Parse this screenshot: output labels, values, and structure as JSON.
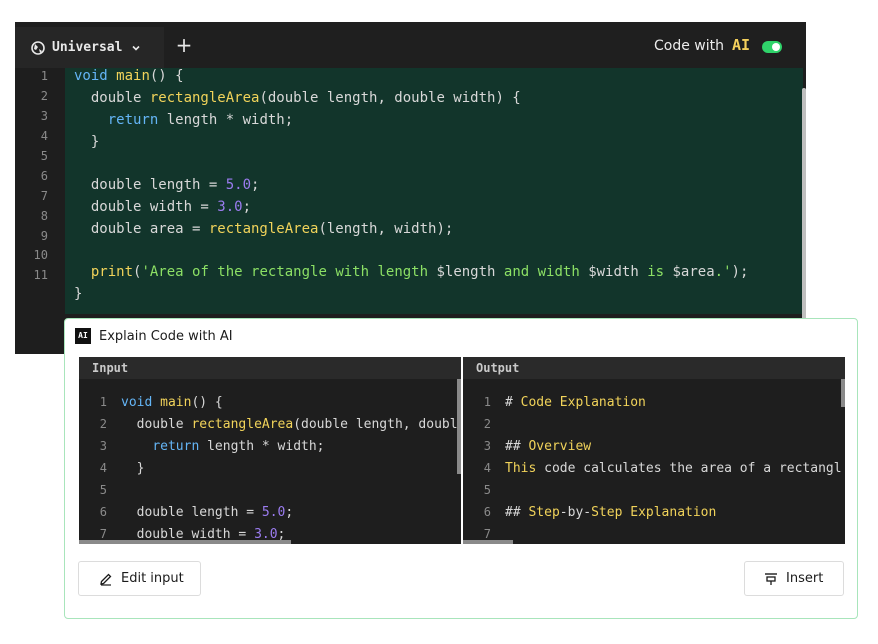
{
  "editor": {
    "tab_label": "Universal",
    "add_tab_symbol": "+",
    "code_with_label": "Code with",
    "ai_label": "AI",
    "toggle_on": true,
    "line_numbers": [
      "1",
      "2",
      "3",
      "4",
      "5",
      "6",
      "7",
      "8",
      "9",
      "10",
      "11"
    ]
  },
  "panel": {
    "badge": "AI",
    "title": "Explain Code with AI",
    "input_header": "Input",
    "output_header": "Output",
    "input_line_numbers": [
      "1",
      "2",
      "3",
      "4",
      "5",
      "6",
      "7"
    ],
    "output_line_numbers": [
      "1",
      "2",
      "3",
      "4",
      "5",
      "6",
      "7"
    ],
    "output_lines": [
      "# Code Explanation",
      "",
      "## Overview",
      "This code calculates the area of a rectangl",
      "",
      "## Step-by-Step Explanation",
      ""
    ],
    "edit_button": "Edit input",
    "insert_button": "Insert"
  },
  "colors": {
    "accent_green": "#2fd36a",
    "code_bg": "#12352b",
    "ai_yellow": "#f4d05c"
  }
}
